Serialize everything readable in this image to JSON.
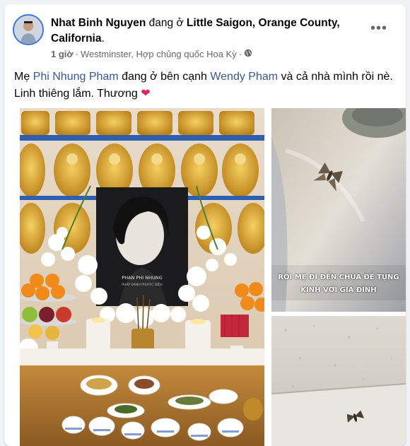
{
  "post": {
    "author": "Nhat Binh Nguyen",
    "verb": "đang ở",
    "location": "Little Saigon, Orange County, California",
    "location_suffix": ".",
    "time": "1 giờ",
    "separator": "·",
    "place_text": "Westminster, Hợp chủng quốc Hoa Kỳ",
    "separator2": "·",
    "privacy_icon": "globe-icon",
    "menu_icon": "more-options-icon",
    "text_part1": "Mẹ ",
    "tag1": "Phi Nhung Pham",
    "text_part2": " đang ở bên cạnh ",
    "tag2": "Wendy Pham",
    "text_part3": " và cả nhà mình rồi nè. Linh thiêng lắm. Thương ",
    "emoji": "❤"
  },
  "photos": {
    "main": {
      "portrait_name": "PHAN PHI NHUNG",
      "portrait_subtitle": "PHÁP DANH PHƯỚC DIỆU"
    },
    "top_right": {
      "caption_line1": "RỒI MẸ ĐI ĐẾN CHÙA ĐỂ TỤNG",
      "caption_line2": "KINH VỚI GIA ĐÌNH"
    }
  },
  "colors": {
    "link": "#385898",
    "meta": "#65676b",
    "background": "#f0f2f5"
  }
}
